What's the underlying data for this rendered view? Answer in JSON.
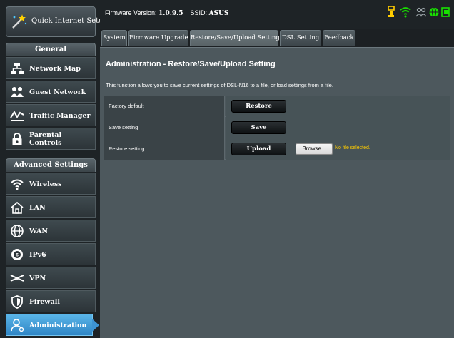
{
  "sidebar": {
    "quick_setup": "Quick Internet Setup",
    "general_header": "General",
    "general_items": [
      {
        "label": "Network Map",
        "icon": "network-map-icon"
      },
      {
        "label": "Guest Network",
        "icon": "guest-network-icon"
      },
      {
        "label": "Traffic Manager",
        "icon": "traffic-manager-icon"
      },
      {
        "label": "Parental Controls",
        "icon": "parental-controls-icon"
      }
    ],
    "advanced_header": "Advanced Settings",
    "advanced_items": [
      {
        "label": "Wireless",
        "icon": "wireless-icon"
      },
      {
        "label": "LAN",
        "icon": "lan-icon"
      },
      {
        "label": "WAN",
        "icon": "wan-icon"
      },
      {
        "label": "IPv6",
        "icon": "ipv6-icon"
      },
      {
        "label": "VPN",
        "icon": "vpn-icon"
      },
      {
        "label": "Firewall",
        "icon": "firewall-icon"
      },
      {
        "label": "Administration",
        "icon": "administration-icon",
        "active": true
      }
    ]
  },
  "topbar": {
    "firmware_label": "Firmware Version:",
    "firmware_value": "1.0.9.5",
    "ssid_label": "SSID:",
    "ssid_value": "ASUS"
  },
  "tabs": [
    {
      "label": "System"
    },
    {
      "label": "Firmware Upgrade"
    },
    {
      "label": "Restore/Save/Upload Setting",
      "active": true
    },
    {
      "label": "DSL Setting"
    },
    {
      "label": "Feedback"
    }
  ],
  "main": {
    "title": "Administration - Restore/Save/Upload Setting",
    "description": "This function allows you to save current settings of DSL-N16 to a file, or load settings from a file.",
    "rows": [
      {
        "label": "Factory default",
        "button": "Restore"
      },
      {
        "label": "Save setting",
        "button": "Save"
      },
      {
        "label": "Restore setting",
        "button": "Upload"
      }
    ],
    "browse_button": "Browse...",
    "file_status": "No file selected."
  },
  "colors": {
    "accent": "#3d93d2",
    "status_icon": "#ffcc00",
    "status_green": "#18e000",
    "file_status": "#ffcc00"
  }
}
